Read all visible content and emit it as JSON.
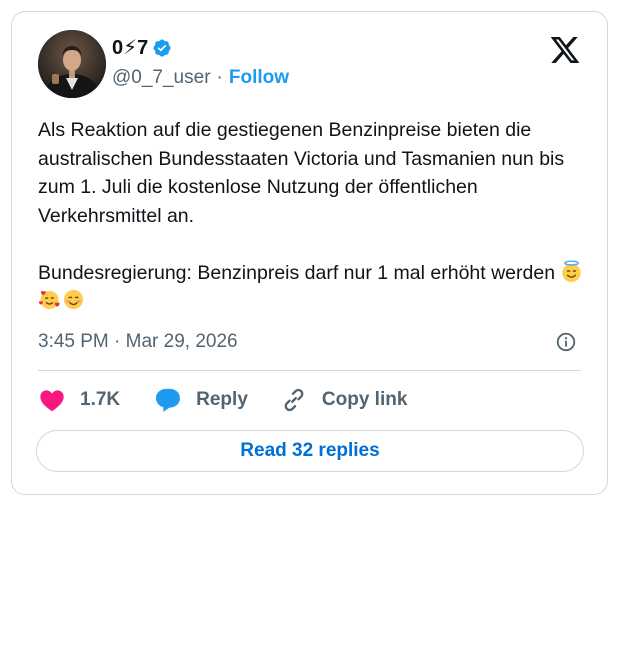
{
  "author": {
    "display_name": "0⚡7",
    "handle": "@0_7_user",
    "separator": "·",
    "follow_label": "Follow",
    "verified_color": "#1d9bf0"
  },
  "tweet": {
    "text": "Als Reaktion auf die gestiegenen Benzinpreise bieten die australischen Bundesstaaten Victoria und Tasmanien nun bis zum 1. Juli die kostenlose Nutzung der öffentlichen Verkehrsmittel an.\n\nBundesregierung: Benzinpreis darf nur 1 mal erhöht werden ",
    "emojis": [
      "smiling-face-with-halo",
      "smiling-face-with-hearts",
      "smiling-face-with-smiling-eyes"
    ],
    "timestamp": "3:45 PM · Mar 29, 2026"
  },
  "actions": {
    "like_count": "1.7K",
    "reply_label": "Reply",
    "copy_link_label": "Copy link",
    "like_color": "#f91880",
    "reply_color": "#1d9bf0"
  },
  "footer": {
    "read_replies_label": "Read 32 replies"
  },
  "icons": {
    "brand": "x-logo-icon",
    "info": "info-icon",
    "like": "heart-icon",
    "reply": "speech-bubble-icon",
    "copy": "link-icon"
  }
}
